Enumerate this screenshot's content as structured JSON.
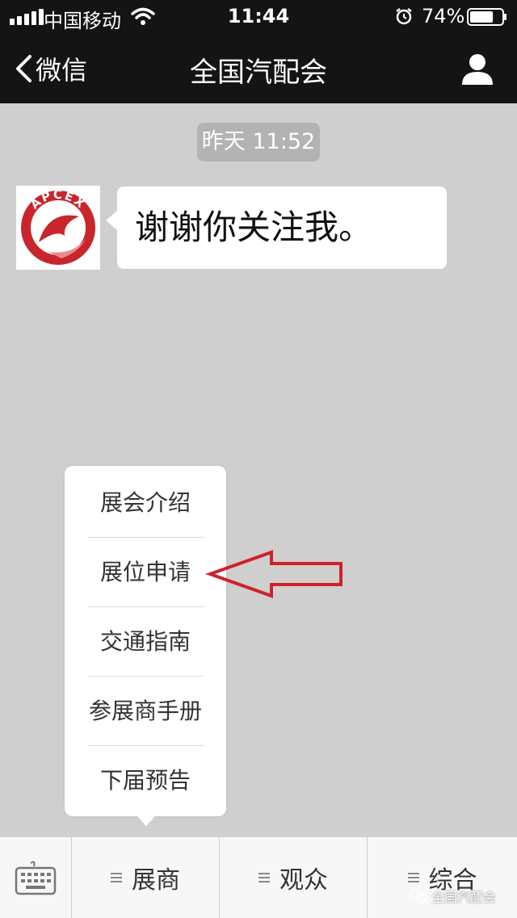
{
  "status_bar": {
    "carrier": "中国移动",
    "time": "11:44",
    "battery_percent": "74%",
    "battery_level": 0.74
  },
  "nav": {
    "back_label": "微信",
    "title": "全国汽配会"
  },
  "chat": {
    "timestamp": "昨天 11:52",
    "avatar_logo_text": "APCEX",
    "message": "谢谢你关注我。"
  },
  "menu_popup": {
    "items": [
      "展会介绍",
      "展位申请",
      "交通指南",
      "参展商手册",
      "下届预告"
    ]
  },
  "bottom_bar": {
    "tabs": [
      {
        "label": "展商"
      },
      {
        "label": "观众"
      },
      {
        "label": "综合"
      }
    ]
  },
  "watermark": "全国汽配会",
  "colors": {
    "dark_bar": "#141414",
    "chat_background": "#cfcfcf",
    "annotation_red": "#d0202a",
    "logo_red": "#c8262c"
  },
  "icons": {
    "back": "chevron-left-icon",
    "profile": "person-icon",
    "keyboard": "keyboard-icon",
    "menu": "menu-lines-icon",
    "wifi": "wifi-icon",
    "alarm": "alarm-icon",
    "battery": "battery-icon",
    "watermark": "wechat-icon"
  }
}
